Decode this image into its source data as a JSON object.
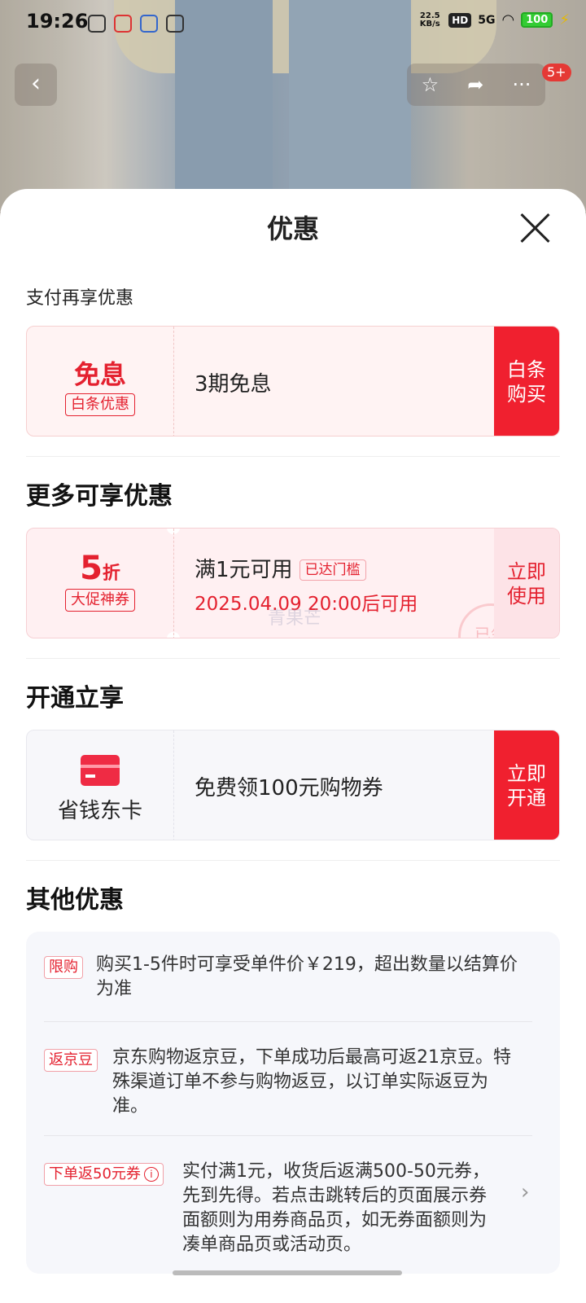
{
  "status_bar": {
    "time": "19:26",
    "network_speed": "22.5 KB/s",
    "hd": "HD",
    "signal": "5G",
    "battery": "100"
  },
  "top_bar": {
    "back_icon": "chevron-left-icon",
    "favorite_icon": "star-icon",
    "share_icon": "share-icon",
    "more_label": "···",
    "badge": "5+"
  },
  "sheet": {
    "title": "优惠",
    "section_pay": {
      "label": "支付再享优惠",
      "card": {
        "left_title": "免息",
        "left_tag": "白条优惠",
        "main": "3期免息",
        "cta": "白条\n购买"
      }
    },
    "section_more": {
      "heading": "更多可享优惠",
      "card": {
        "discount_num": "5",
        "discount_unit": "折",
        "left_tag": "大促神券",
        "main": "满1元可用",
        "met_tag": "已达门槛",
        "time": "2025.04.09 20:00后可用",
        "watermark": "青果芒",
        "stamp": "已领",
        "cta": "立即\n使用"
      }
    },
    "section_open": {
      "heading": "开通立享",
      "card": {
        "name": "省钱东卡",
        "main": "免费领100元购物券",
        "cta": "立即\n开通"
      }
    },
    "section_other": {
      "heading": "其他优惠",
      "items": [
        {
          "tag": "限购",
          "text": "购买1-5件时可享受单件价￥219，超出数量以结算价为准"
        },
        {
          "tag": "返京豆",
          "text": "京东购物返京豆，下单成功后最高可返21京豆。特殊渠道订单不参与购物返豆，以订单实际返豆为准。"
        },
        {
          "tag": "下单返50元券",
          "text": "实付满1元，收货后返满500-50元券，先到先得。若点击跳转后的页面展示券面额则为用券商品页，如无券面额则为凑单商品页或活动页。"
        }
      ]
    }
  },
  "colors": {
    "accent": "#f0202f",
    "red_text": "#e4212f"
  }
}
